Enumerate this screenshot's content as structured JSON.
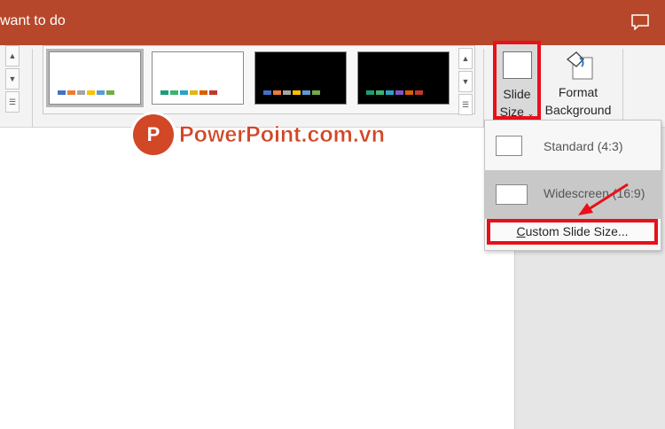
{
  "titlebar": {
    "title": "want to do",
    "bg": "#b7472a"
  },
  "gallery": {
    "themes": [
      {
        "bg": "#ffffff",
        "selected": true,
        "colors": [
          "#4472c4",
          "#ed7d31",
          "#a5a5a5",
          "#ffc000",
          "#5b9bd5",
          "#70ad47"
        ]
      },
      {
        "bg": "#ffffff",
        "selected": false,
        "colors": [
          "#1b9e77",
          "#3cb371",
          "#2aa3c7",
          "#e2b512",
          "#d95f02",
          "#c0392b"
        ]
      },
      {
        "bg": "#000000",
        "selected": false,
        "colors": [
          "#4472c4",
          "#ed7d31",
          "#a5a5a5",
          "#ffc000",
          "#5b9bd5",
          "#70ad47"
        ]
      },
      {
        "bg": "#000000",
        "selected": false,
        "colors": [
          "#1b9e77",
          "#3cb371",
          "#2aa3c7",
          "#7e57c2",
          "#d95f02",
          "#c0392b"
        ]
      }
    ]
  },
  "ribbon": {
    "slide_size_line1": "Slide",
    "slide_size_line2": "Size",
    "format_bg_line1": "Format",
    "format_bg_line2": "Background"
  },
  "watermark": {
    "logo_glyph": "P",
    "text": "PowerPoint.com.vn"
  },
  "dropdown": {
    "standard_label": "Standard (4:3)",
    "widescreen_label": "Widescreen (16:9)",
    "custom_label": "Custom Slide Size..."
  },
  "colors": {
    "highlight": "#e8101a",
    "brand": "#d24726"
  }
}
